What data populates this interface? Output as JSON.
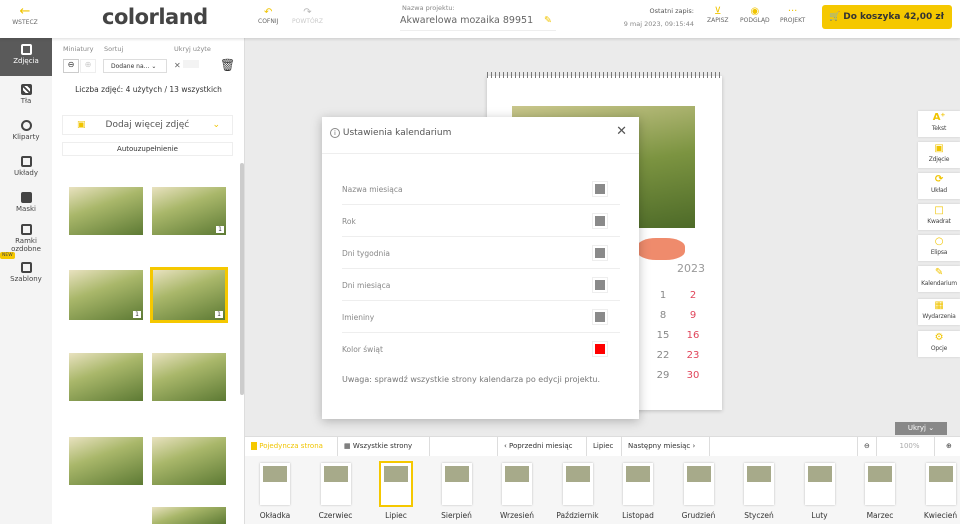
{
  "header": {
    "back": "WSTECZ",
    "logo": "colorland",
    "undo": "COFNIJ",
    "redo": "POWTÓRZ",
    "project_label": "Nazwa projektu:",
    "project_name": "Akwarelowa mozaika 89951",
    "last_save_label": "Ostatni zapis:",
    "last_save": "9 maj 2023, 09:15:44",
    "save": "ZAPISZ",
    "preview": "PODGLĄD",
    "project": "PROJEKT",
    "cart": "Do koszyka",
    "price": "42,00 zł"
  },
  "rail": [
    {
      "label": "Zdjęcia",
      "active": true
    },
    {
      "label": "Tła"
    },
    {
      "label": "Kliparty"
    },
    {
      "label": "Układy"
    },
    {
      "label": "Maski"
    },
    {
      "label": "Ramki ozdobne"
    },
    {
      "label": "Szablony",
      "badge": "NEW"
    }
  ],
  "panel": {
    "thumbs_label": "Miniatury",
    "sort_label": "Sortuj",
    "sort_value": "Dodane na...",
    "hide_used_label": "Ukryj użyte",
    "count": "Liczba zdjęć: 4 użytych / 13 wszystkich",
    "add_more": "Dodaj więcej zdjęć",
    "autofill": "Autouzupełnienie",
    "photo_counts": [
      "",
      "1",
      "1",
      "1",
      "",
      "",
      "",
      "",
      ""
    ]
  },
  "modal": {
    "title": "Ustawienia kalendarium",
    "rows": [
      {
        "label": "Nazwa miesiąca",
        "color": "#8a8a8a"
      },
      {
        "label": "Rok",
        "color": "#8a8a8a"
      },
      {
        "label": "Dni tygodnia",
        "color": "#8a8a8a"
      },
      {
        "label": "Dni miesiąca",
        "color": "#8a8a8a"
      },
      {
        "label": "Imieniny",
        "color": "#8a8a8a"
      },
      {
        "label": "Kolor świąt",
        "color": "#ff0000"
      }
    ],
    "note": "Uwaga: sprawdź wszystkie strony kalendarza po edycji projektu."
  },
  "calendar": {
    "year": "2023",
    "col1": [
      "1",
      "8",
      "15",
      "22",
      "29"
    ],
    "col2": [
      "2",
      "9",
      "16",
      "23",
      "30"
    ]
  },
  "tools": [
    "Tekst",
    "Zdjęcie",
    "Układ",
    "Kwadrat",
    "Elipsa",
    "Kalendarium",
    "Wydarzenia",
    "Opcje"
  ],
  "bottom": {
    "hide": "Ukryj",
    "single": "Pojedyncza strona",
    "all": "Wszystkie strony",
    "prev": "Poprzedni miesiąc",
    "current": "Lipiec",
    "next": "Następny miesiąc",
    "zoom": "100%",
    "pages": [
      "Okładka",
      "Czerwiec",
      "Lipiec",
      "Sierpień",
      "Wrzesień",
      "Październik",
      "Listopad",
      "Grudzień",
      "Styczeń",
      "Luty",
      "Marzec",
      "Kwiecień"
    ]
  },
  "colors": {
    "accent": "#f5c800",
    "active_rail": "#5a5a5a"
  }
}
